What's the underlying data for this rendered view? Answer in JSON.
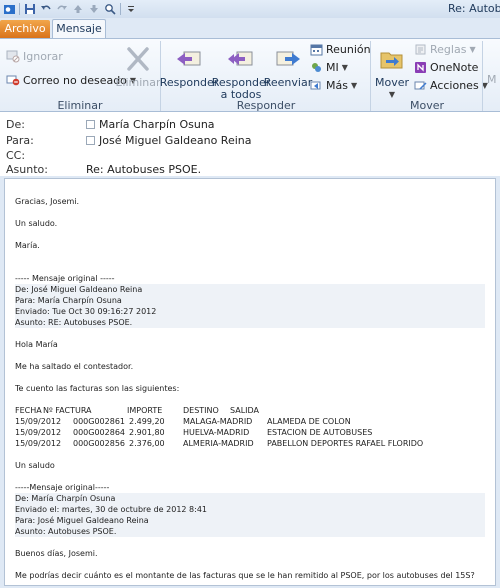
{
  "window": {
    "title": "Re: Autob"
  },
  "quick_access": {
    "icons": [
      "outlook-icon",
      "save-icon",
      "undo-icon",
      "redo-icon",
      "up-arrow-icon",
      "down-arrow-icon",
      "zoom-icon",
      "customize-icon"
    ]
  },
  "tabs": {
    "file": "Archivo",
    "message": "Mensaje"
  },
  "ribbon": {
    "eliminar_group": {
      "ignore": "Ignorar",
      "junk": "Correo no deseado",
      "delete": "Eliminar",
      "label": "Eliminar"
    },
    "responder_group": {
      "reply": "Responder",
      "reply_all_line1": "Responder",
      "reply_all_line2": "a todos",
      "forward": "Reenviar",
      "meeting": "Reunión",
      "im": "MI",
      "more": "Más",
      "label": "Responder"
    },
    "mover_group": {
      "move": "Mover",
      "rules": "Reglas",
      "onenote": "OneNote",
      "actions": "Acciones",
      "label": "Mover"
    },
    "overflow": "M"
  },
  "header": {
    "from_label": "De:",
    "from_value": "María Charpín Osuna",
    "to_label": "Para:",
    "to_value": "José Miguel Galdeano Reina",
    "cc_label": "CC:",
    "subject_label": "Asunto:",
    "subject_value": "Re: Autobuses PSOE."
  },
  "body": {
    "l1": "Gracias, Josemi.",
    "l2": "Un saludo.",
    "l3": "María.",
    "orig_header": "----- Mensaje original -----",
    "orig_from": "De: José Miguel Galdeano Reina",
    "orig_to": "Para: María Charpín Osuna",
    "orig_sent": "Enviado: Tue Oct 30 09:16:27 2012",
    "orig_subject": "Asunto: RE: Autobuses PSOE.",
    "hola": "Hola María",
    "contestador": "Me ha saltado el contestador.",
    "facturas": "Te cuento las facturas son las siguientes:",
    "table_headers": [
      "FECHA",
      "Nº FACTURA",
      "IMPORTE",
      "DESTINO",
      "SALIDA"
    ],
    "table_rows": [
      [
        "15/09/2012",
        "000G002861",
        "2.499,20",
        "MALAGA-MADRID",
        "ALAMEDA DE COLON"
      ],
      [
        "15/09/2012",
        "000G002864",
        "2.901,80",
        "HUELVA-MADRID",
        "ESTACION DE AUTOBUSES"
      ],
      [
        "15/09/2012",
        "000G002856",
        "2.376,00",
        "ALMERIA-MADRID",
        "PABELLON DEPORTES RAFAEL FLORIDO"
      ]
    ],
    "un_saludo": "Un saludo",
    "orig2_header": "-----Mensaje original-----",
    "orig2_from": "De: María Charpín Osuna",
    "orig2_sent": "Enviado el: martes, 30 de octubre de 2012 8:41",
    "orig2_to": "Para: José Miguel Galdeano Reina",
    "orig2_subject": "Asunto: Autobuses PSOE.",
    "buenos": "Buenos días, Josemi.",
    "pregunta": "Me podrías decir cuánto es el montante de las facturas que se le han remitido al PSOE, por los autobuses del 15S?"
  }
}
